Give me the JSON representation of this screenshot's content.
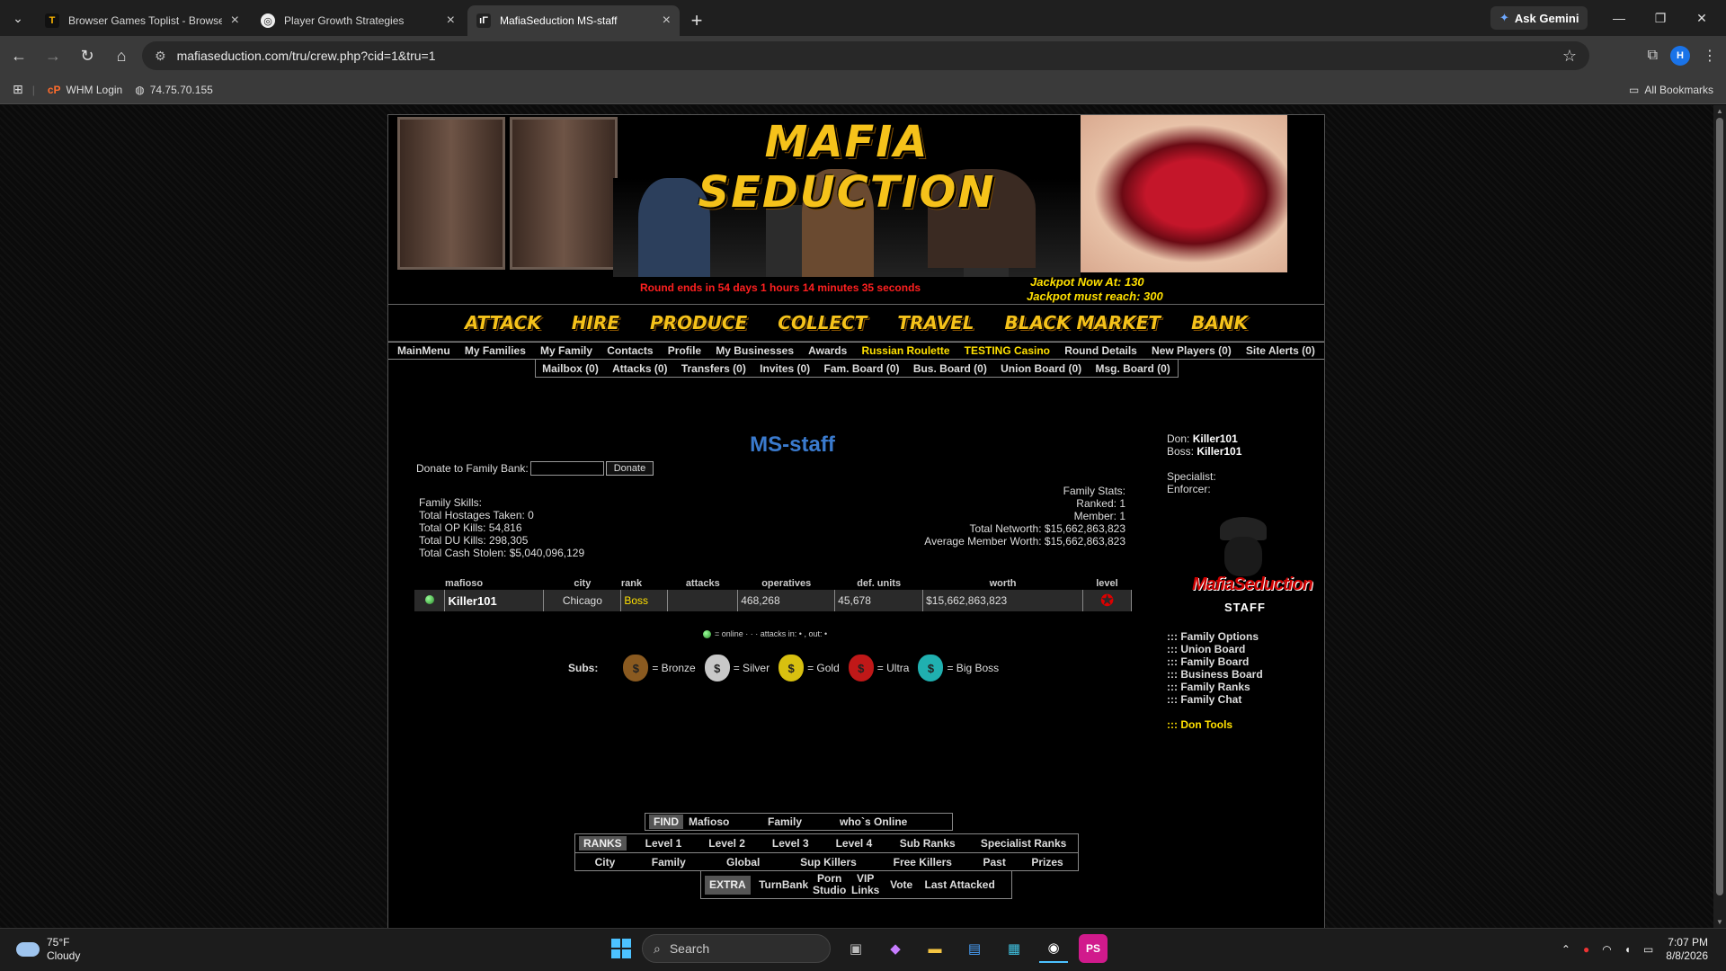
{
  "browser": {
    "tabs": [
      {
        "label": "Browser Games Toplist - Browse",
        "fav": "T",
        "active": false
      },
      {
        "label": "Player Growth Strategies",
        "fav": "◎",
        "active": false
      },
      {
        "label": "MafiaSeduction MS-staff",
        "fav": "ıΓ",
        "active": true
      }
    ],
    "gemini_label": "Ask Gemini",
    "url": "mafiaseduction.com/tru/crew.php?cid=1&tru=1",
    "profile_initial": "H",
    "bookmarks": [
      {
        "label": "WHM Login"
      },
      {
        "label": "74.75.70.155"
      }
    ],
    "all_bookmarks_label": "All Bookmarks"
  },
  "banner": {
    "title": "MAFIA SEDUCTION",
    "round_text": "Round ends in 54 days 1 hours 14 minutes 35 seconds",
    "jackpot_now": "Jackpot Now At: 130",
    "jackpot_reach": "Jackpot must reach: 300"
  },
  "actions": [
    "ATTACK",
    "HIRE",
    "PRODUCE",
    "COLLECT",
    "TRAVEL",
    "BLACK MARKET",
    "BANK"
  ],
  "menu1": [
    "MainMenu",
    "My Families",
    "My Family",
    "Contacts",
    "Profile",
    "My Businesses",
    "Awards",
    "Russian Roulette",
    "TESTING Casino",
    "Round Details",
    "New Players (0)",
    "Site Alerts (0)"
  ],
  "menu2": [
    "Mailbox (0)",
    "Attacks (0)",
    "Transfers (0)",
    "Invites (0)",
    "Fam. Board (0)",
    "Bus. Board (0)",
    "Union Board (0)",
    "Msg. Board (0)"
  ],
  "family": {
    "name": "MS-staff",
    "donate_label": "Donate to Family Bank:",
    "donate_button": "Donate",
    "skills_lines": [
      "Family Skills:",
      "Total Hostages Taken: 0",
      "Total OP Kills: 54,816",
      "Total DU Kills: 298,305",
      "Total Cash Stolen: $5,040,096,129"
    ],
    "stats_lines": [
      "Family Stats:",
      "Ranked: 1",
      "Member: 1",
      "Total Networth: $15,662,863,823",
      "Average Member Worth: $15,662,863,823"
    ]
  },
  "crew_table": {
    "headers": [
      "",
      "mafioso",
      "city",
      "rank",
      "attacks",
      "operatives",
      "def. units",
      "worth",
      "level"
    ],
    "rows": [
      {
        "name": "Killer101",
        "city": "Chicago",
        "rank": "Boss",
        "attacks": "",
        "operatives": "468,268",
        "def_units": "45,678",
        "worth": "$15,662,863,823"
      }
    ]
  },
  "legend_text": "= online · · · attacks in: • , out: •",
  "subs": {
    "label": "Subs:",
    "items": [
      {
        "label": "= Bronze",
        "color": "#8a5a20"
      },
      {
        "label": "= Silver",
        "color": "#c8c8c8"
      },
      {
        "label": "= Gold",
        "color": "#d8c010"
      },
      {
        "label": "= Ultra",
        "color": "#c01818"
      },
      {
        "label": "= Big Boss",
        "color": "#20b0b0"
      }
    ]
  },
  "side": {
    "don_label": "Don:",
    "don": "Killer101",
    "boss_label": "Boss:",
    "boss": "Killer101",
    "specialist_label": "Specialist:",
    "enforcer_label": "Enforcer:",
    "logo_text": "MafiaSeduction",
    "logo_sub": "STAFF",
    "links": [
      "::: Family Options",
      "::: Union Board",
      "::: Family Board",
      "::: Business Board",
      "::: Family Ranks",
      "::: Family Chat"
    ],
    "don_tools": "::: Don Tools"
  },
  "find": {
    "tag": "FIND",
    "items": [
      "Mafioso",
      "Family",
      "who`s Online"
    ]
  },
  "ranks": {
    "tag": "RANKS",
    "row1": [
      "Level 1",
      "Level 2",
      "Level 3",
      "Level 4",
      "Sub Ranks",
      "Specialist Ranks"
    ],
    "row2": [
      "City",
      "Family",
      "Global",
      "Sup Killers",
      "Free Killers",
      "Past",
      "Prizes"
    ]
  },
  "extra": {
    "tag": "EXTRA",
    "items": [
      "TurnBank",
      "Porn Studio",
      "VIP Links",
      "Vote",
      "Last Attacked"
    ]
  },
  "taskbar": {
    "temp": "75°F",
    "condition": "Cloudy",
    "search_placeholder": "Search",
    "time": "7:07 PM",
    "date": "8/8/2026"
  }
}
